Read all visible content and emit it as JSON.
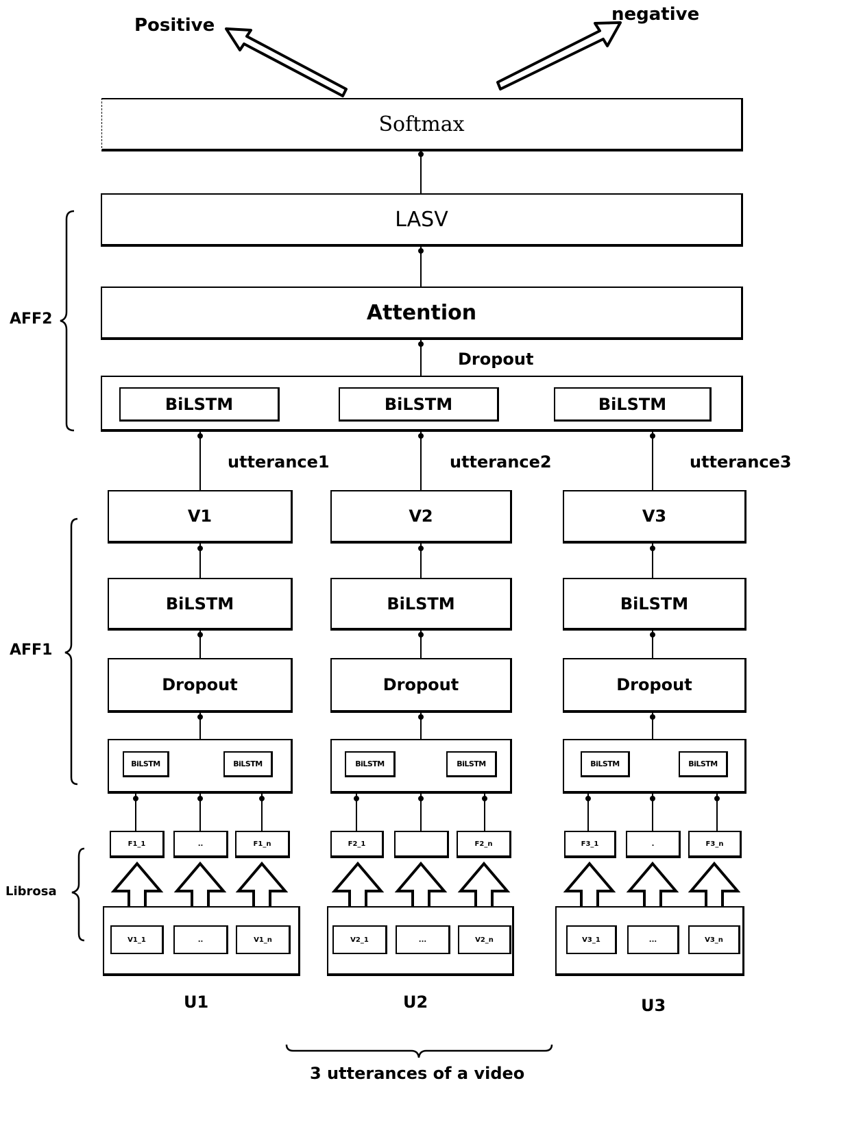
{
  "outputs": {
    "positive": "Positive",
    "negative": "negative"
  },
  "top_layers": {
    "softmax": "Softmax",
    "lasv": "LASV",
    "attention": "Attention",
    "dropout": "Dropout",
    "bilstm_row": [
      "BiLSTM",
      "BiLSTM",
      "BiLSTM"
    ]
  },
  "groups": {
    "aff2": "AFF2",
    "aff1": "AFF1",
    "librosa": "Librosa"
  },
  "columns": [
    {
      "utterance_label": "utterance1",
      "vector": "V1",
      "bilstm": "BiLSTM",
      "dropout": "Dropout",
      "inner_bilstm": [
        "BiLSTM",
        "BiLSTM"
      ],
      "features": [
        "F1_1",
        "..",
        "F1_n"
      ],
      "inputs": [
        "V1_1",
        "..",
        "V1_n"
      ],
      "utterance_id": "U1"
    },
    {
      "utterance_label": "utterance2",
      "vector": "V2",
      "bilstm": "BiLSTM",
      "dropout": "Dropout",
      "inner_bilstm": [
        "BiLSTM",
        "BiLSTM"
      ],
      "features": [
        "F2_1",
        "",
        "F2_n"
      ],
      "inputs": [
        "V2_1",
        "...",
        "V2_n"
      ],
      "utterance_id": "U2"
    },
    {
      "utterance_label": "utterance3",
      "vector": "V3",
      "bilstm": "BiLSTM",
      "dropout": "Dropout",
      "inner_bilstm": [
        "BiLSTM",
        "BiLSTM"
      ],
      "features": [
        "F3_1",
        ".",
        "F3_n"
      ],
      "inputs": [
        "V3_1",
        "...",
        "V3_n"
      ],
      "utterance_id": "U3"
    }
  ],
  "footer": {
    "caption": "3 utterances of a video"
  }
}
